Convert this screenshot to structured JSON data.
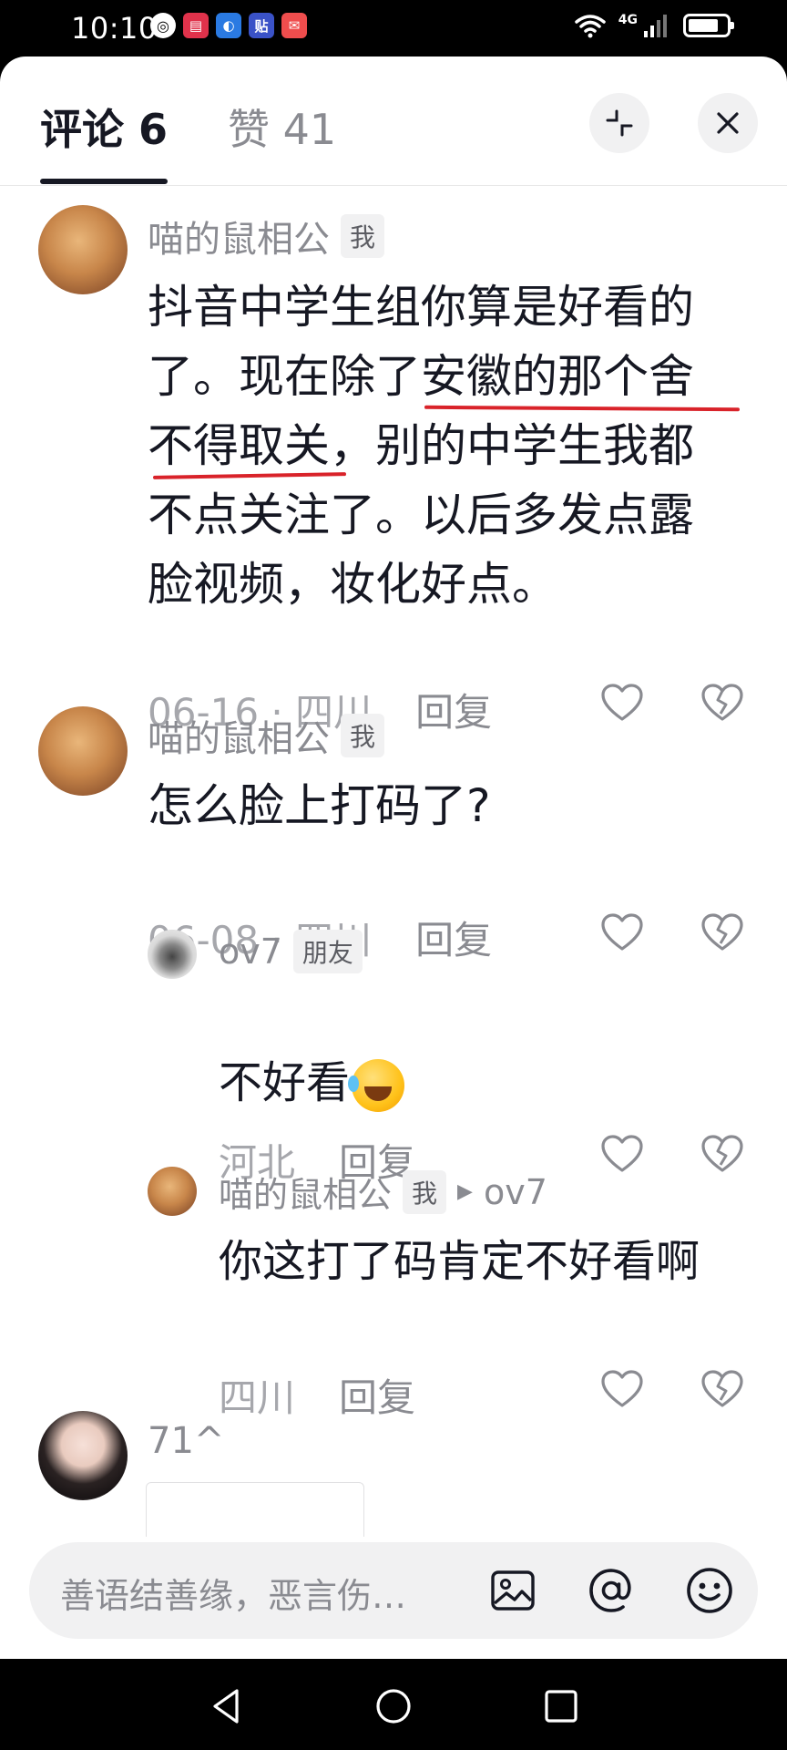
{
  "status_bar": {
    "time": "10:10",
    "network": "4G",
    "battery_level": 0.8,
    "apps": [
      {
        "name": "browser-icon",
        "glyph": "◎"
      },
      {
        "name": "reader-icon",
        "glyph": "▤"
      },
      {
        "name": "maps-icon",
        "glyph": "◐"
      },
      {
        "name": "tieba-icon",
        "glyph": "贴"
      },
      {
        "name": "mall-icon",
        "glyph": "✉"
      }
    ]
  },
  "header": {
    "tab_comments": "评论 6",
    "tab_likes": "赞 41"
  },
  "comments": [
    {
      "nickname": "喵的鼠相公",
      "badge": "我",
      "text": "抖音中学生组你算是好看的\n了。现在除了安徽的那个舍\n不得取关，别的中学生我都\n不点关注了。以后多发点露\n脸视频，妆化好点。",
      "meta": "06-16 · 四川",
      "reply": "回复"
    },
    {
      "nickname": "喵的鼠相公",
      "badge": "我",
      "text": "怎么脸上打码了?",
      "meta": "06-08 · 四川",
      "reply": "回复"
    }
  ],
  "replies": [
    {
      "nickname": "ov7",
      "badge": "朋友",
      "text": "不好看",
      "emoji": "rofl-emoji",
      "meta": "河北",
      "reply": "回复"
    },
    {
      "nickname": "喵的鼠相公",
      "badge": "我",
      "reply_to": "ov7",
      "text": "你这打了码肯定不好看啊",
      "meta": "四川",
      "reply": "回复"
    }
  ],
  "partial_comment": {
    "nickname": "71^"
  },
  "input_bar": {
    "placeholder": "善语结善缘，恶言伤…"
  },
  "colors": {
    "primary_text": "#161823",
    "secondary_text": "#8a8b91",
    "highlight_underline": "#d9232a"
  }
}
